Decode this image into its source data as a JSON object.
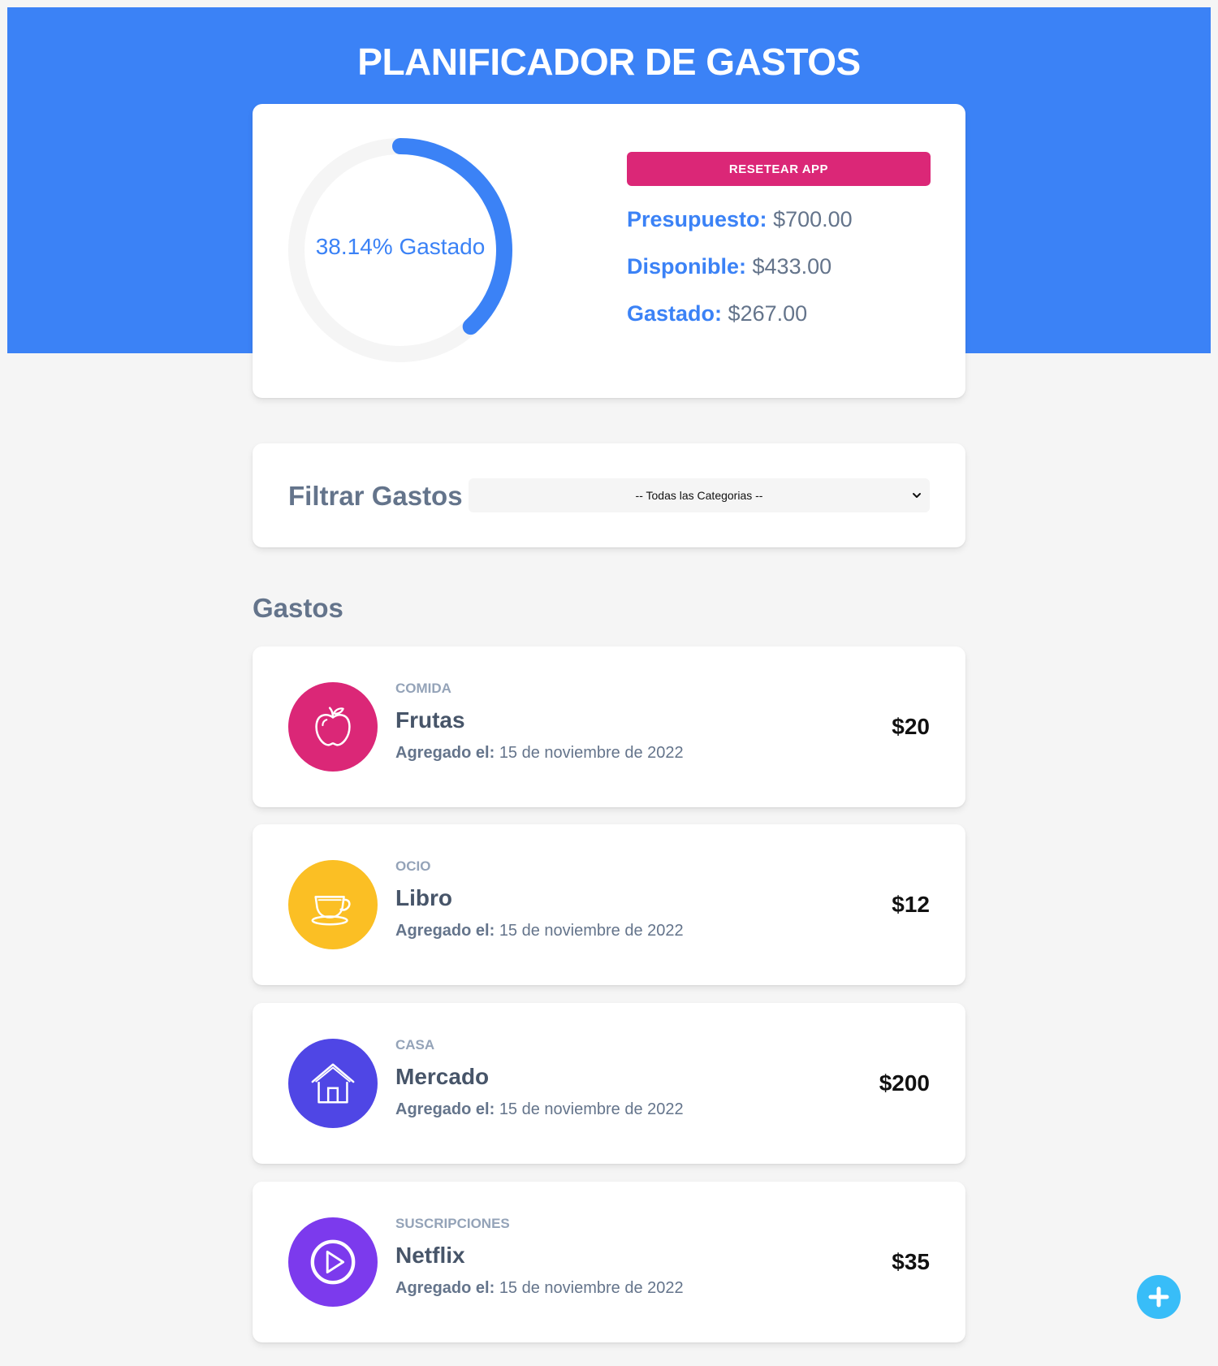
{
  "header": {
    "title": "PLANIFICADOR DE GASTOS"
  },
  "budget": {
    "percent_spent": 38.14,
    "gauge_label": "38.14% Gastado",
    "reset_label": "RESETEAR APP",
    "budget_key": "Presupuesto:",
    "budget_value": "$700.00",
    "available_key": "Disponible:",
    "available_value": "$433.00",
    "spent_key": "Gastado:",
    "spent_value": "$267.00"
  },
  "filter": {
    "label": "Filtrar Gastos",
    "selected": "-- Todas las Categorias --"
  },
  "expenses_section": {
    "title": "Gastos"
  },
  "expenses": [
    {
      "category": "COMIDA",
      "name": "Frutas",
      "date_key": "Agregado el:",
      "date": "15 de noviembre de 2022",
      "amount": "$20",
      "icon": "apple-icon",
      "color": "#db2777"
    },
    {
      "category": "OCIO",
      "name": "Libro",
      "date_key": "Agregado el:",
      "date": "15 de noviembre de 2022",
      "amount": "$12",
      "icon": "teacup-icon",
      "color": "#fbbf24"
    },
    {
      "category": "CASA",
      "name": "Mercado",
      "date_key": "Agregado el:",
      "date": "15 de noviembre de 2022",
      "amount": "$200",
      "icon": "house-icon",
      "color": "#4f46e5"
    },
    {
      "category": "SUSCRIPCIONES",
      "name": "Netflix",
      "date_key": "Agregado el:",
      "date": "15 de noviembre de 2022",
      "amount": "$35",
      "icon": "play-icon",
      "color": "#7c3aed"
    }
  ],
  "fab": {
    "icon": "plus-icon"
  },
  "colors": {
    "primary": "#3b82f6",
    "reset": "#db2777",
    "fab": "#38bdf8",
    "gauge_track": "#f5f5f5"
  }
}
